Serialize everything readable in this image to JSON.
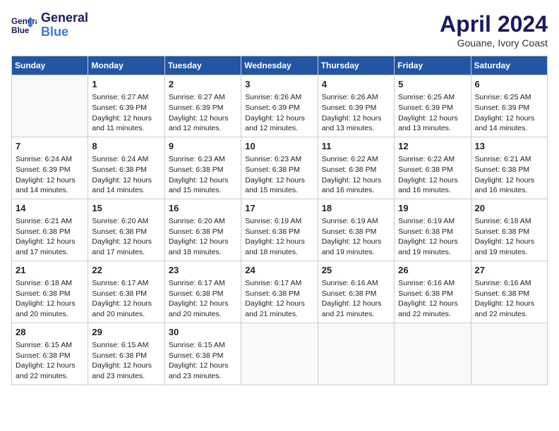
{
  "header": {
    "logo_line1": "General",
    "logo_line2": "Blue",
    "month": "April 2024",
    "location": "Gouane, Ivory Coast"
  },
  "days_of_week": [
    "Sunday",
    "Monday",
    "Tuesday",
    "Wednesday",
    "Thursday",
    "Friday",
    "Saturday"
  ],
  "weeks": [
    [
      {
        "day": "",
        "info": ""
      },
      {
        "day": "1",
        "info": "Sunrise: 6:27 AM\nSunset: 6:39 PM\nDaylight: 12 hours\nand 11 minutes."
      },
      {
        "day": "2",
        "info": "Sunrise: 6:27 AM\nSunset: 6:39 PM\nDaylight: 12 hours\nand 12 minutes."
      },
      {
        "day": "3",
        "info": "Sunrise: 6:26 AM\nSunset: 6:39 PM\nDaylight: 12 hours\nand 12 minutes."
      },
      {
        "day": "4",
        "info": "Sunrise: 6:26 AM\nSunset: 6:39 PM\nDaylight: 12 hours\nand 13 minutes."
      },
      {
        "day": "5",
        "info": "Sunrise: 6:25 AM\nSunset: 6:39 PM\nDaylight: 12 hours\nand 13 minutes."
      },
      {
        "day": "6",
        "info": "Sunrise: 6:25 AM\nSunset: 6:39 PM\nDaylight: 12 hours\nand 14 minutes."
      }
    ],
    [
      {
        "day": "7",
        "info": "Sunrise: 6:24 AM\nSunset: 6:39 PM\nDaylight: 12 hours\nand 14 minutes."
      },
      {
        "day": "8",
        "info": "Sunrise: 6:24 AM\nSunset: 6:38 PM\nDaylight: 12 hours\nand 14 minutes."
      },
      {
        "day": "9",
        "info": "Sunrise: 6:23 AM\nSunset: 6:38 PM\nDaylight: 12 hours\nand 15 minutes."
      },
      {
        "day": "10",
        "info": "Sunrise: 6:23 AM\nSunset: 6:38 PM\nDaylight: 12 hours\nand 15 minutes."
      },
      {
        "day": "11",
        "info": "Sunrise: 6:22 AM\nSunset: 6:38 PM\nDaylight: 12 hours\nand 16 minutes."
      },
      {
        "day": "12",
        "info": "Sunrise: 6:22 AM\nSunset: 6:38 PM\nDaylight: 12 hours\nand 16 minutes."
      },
      {
        "day": "13",
        "info": "Sunrise: 6:21 AM\nSunset: 6:38 PM\nDaylight: 12 hours\nand 16 minutes."
      }
    ],
    [
      {
        "day": "14",
        "info": "Sunrise: 6:21 AM\nSunset: 6:38 PM\nDaylight: 12 hours\nand 17 minutes."
      },
      {
        "day": "15",
        "info": "Sunrise: 6:20 AM\nSunset: 6:38 PM\nDaylight: 12 hours\nand 17 minutes."
      },
      {
        "day": "16",
        "info": "Sunrise: 6:20 AM\nSunset: 6:38 PM\nDaylight: 12 hours\nand 18 minutes."
      },
      {
        "day": "17",
        "info": "Sunrise: 6:19 AM\nSunset: 6:38 PM\nDaylight: 12 hours\nand 18 minutes."
      },
      {
        "day": "18",
        "info": "Sunrise: 6:19 AM\nSunset: 6:38 PM\nDaylight: 12 hours\nand 19 minutes."
      },
      {
        "day": "19",
        "info": "Sunrise: 6:19 AM\nSunset: 6:38 PM\nDaylight: 12 hours\nand 19 minutes."
      },
      {
        "day": "20",
        "info": "Sunrise: 6:18 AM\nSunset: 6:38 PM\nDaylight: 12 hours\nand 19 minutes."
      }
    ],
    [
      {
        "day": "21",
        "info": "Sunrise: 6:18 AM\nSunset: 6:38 PM\nDaylight: 12 hours\nand 20 minutes."
      },
      {
        "day": "22",
        "info": "Sunrise: 6:17 AM\nSunset: 6:38 PM\nDaylight: 12 hours\nand 20 minutes."
      },
      {
        "day": "23",
        "info": "Sunrise: 6:17 AM\nSunset: 6:38 PM\nDaylight: 12 hours\nand 20 minutes."
      },
      {
        "day": "24",
        "info": "Sunrise: 6:17 AM\nSunset: 6:38 PM\nDaylight: 12 hours\nand 21 minutes."
      },
      {
        "day": "25",
        "info": "Sunrise: 6:16 AM\nSunset: 6:38 PM\nDaylight: 12 hours\nand 21 minutes."
      },
      {
        "day": "26",
        "info": "Sunrise: 6:16 AM\nSunset: 6:38 PM\nDaylight: 12 hours\nand 22 minutes."
      },
      {
        "day": "27",
        "info": "Sunrise: 6:16 AM\nSunset: 6:38 PM\nDaylight: 12 hours\nand 22 minutes."
      }
    ],
    [
      {
        "day": "28",
        "info": "Sunrise: 6:15 AM\nSunset: 6:38 PM\nDaylight: 12 hours\nand 22 minutes."
      },
      {
        "day": "29",
        "info": "Sunrise: 6:15 AM\nSunset: 6:38 PM\nDaylight: 12 hours\nand 23 minutes."
      },
      {
        "day": "30",
        "info": "Sunrise: 6:15 AM\nSunset: 6:38 PM\nDaylight: 12 hours\nand 23 minutes."
      },
      {
        "day": "",
        "info": ""
      },
      {
        "day": "",
        "info": ""
      },
      {
        "day": "",
        "info": ""
      },
      {
        "day": "",
        "info": ""
      }
    ]
  ]
}
